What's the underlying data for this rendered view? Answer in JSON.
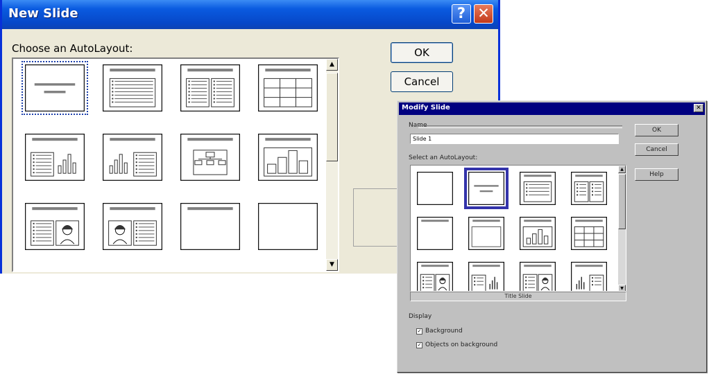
{
  "new_slide_dialog": {
    "title": "New Slide",
    "help_glyph": "?",
    "close_glyph": "✕",
    "prompt": "Choose an AutoLayout:",
    "ok_label": "OK",
    "cancel_label": "Cancel",
    "selected_layout_index": 0,
    "layouts": [
      "title-slide",
      "bulleted-list",
      "two-column-text",
      "table",
      "text-and-chart",
      "chart-and-text",
      "organization-chart",
      "chart",
      "text-and-clip-art",
      "clip-art-and-text",
      "title-only",
      "blank"
    ]
  },
  "modify_slide_dialog": {
    "title": "Modify Slide",
    "name_label": "Name",
    "name_value": "Slide 1",
    "layout_label": "Select an AutoLayout:",
    "ok_label": "OK",
    "cancel_label": "Cancel",
    "help_label": "Help",
    "selected_layout_index": 1,
    "selected_layout_name": "Title Slide",
    "layouts": [
      "blank",
      "title-slide",
      "bulleted-list",
      "two-column-text",
      "title-only",
      "blank-frame",
      "chart",
      "table",
      "text-and-clip-art",
      "text-and-chart",
      "text-and-clip-art-2",
      "chart-and-text"
    ],
    "display_label": "Display",
    "checkboxes": [
      {
        "label": "Background",
        "checked": true
      },
      {
        "label": "Objects on background",
        "checked": true
      }
    ]
  },
  "colors": {
    "xp_title_blue": "#0a5be0",
    "classic_title_navy": "#000080",
    "selection_dotted": "#1c3faa",
    "selection_solid": "#3333aa"
  }
}
